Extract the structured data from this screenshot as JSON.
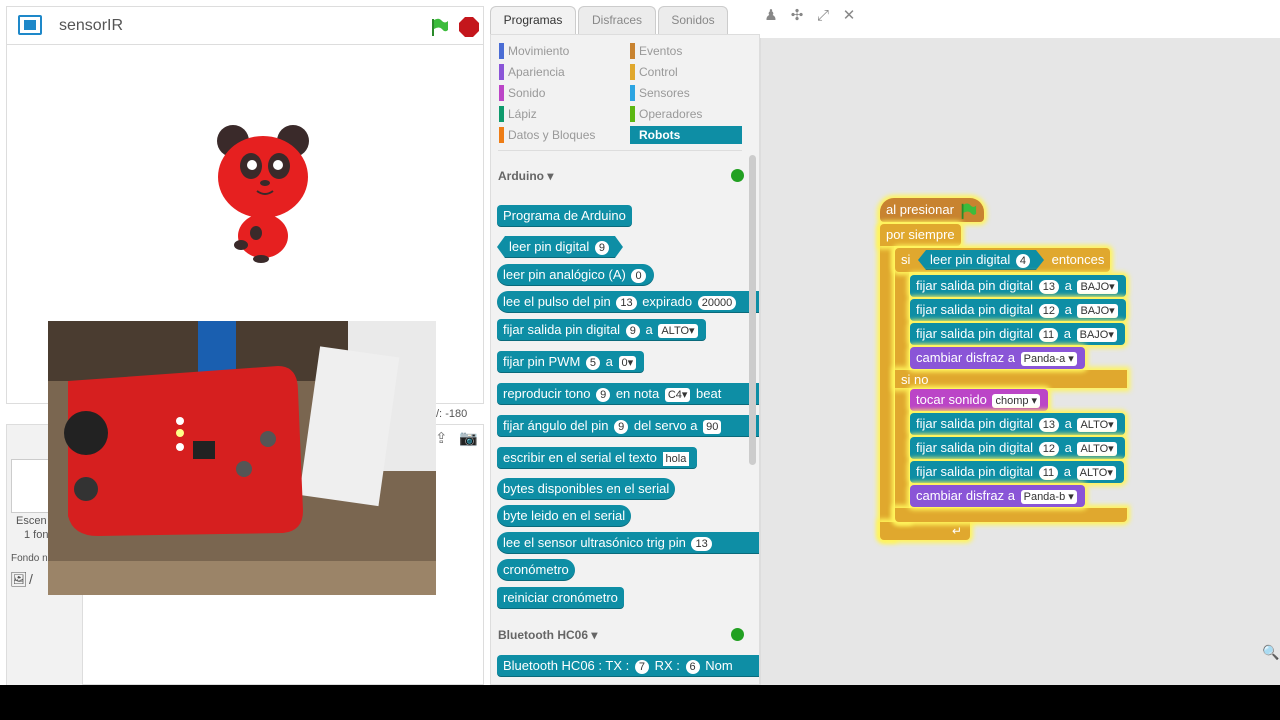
{
  "stage": {
    "project_title": "sensorIR",
    "coords_label": "-180",
    "coords_prefix": "/:"
  },
  "sprite_panel": {
    "stage_label": "Escen",
    "backdrop_count": "1 fon",
    "new_backdrop": "Fondo n"
  },
  "tabs": [
    "Programas",
    "Disfraces",
    "Sonidos"
  ],
  "categories": [
    {
      "label": "Movimiento",
      "color": "#4a6cd4"
    },
    {
      "label": "Apariencia",
      "color": "#8a55d7"
    },
    {
      "label": "Sonido",
      "color": "#bb45c7"
    },
    {
      "label": "Lápiz",
      "color": "#0e9a6c"
    },
    {
      "label": "Datos y Bloques",
      "color": "#ee7d16"
    },
    {
      "label": "Eventos",
      "color": "#c88330"
    },
    {
      "label": "Control",
      "color": "#e0a82e"
    },
    {
      "label": "Sensores",
      "color": "#2ca5e2"
    },
    {
      "label": "Operadores",
      "color": "#5cb712"
    },
    {
      "label": "Robots",
      "color": "#0e8ea5"
    }
  ],
  "palette": {
    "arduino_header": "Arduino",
    "bluetooth_header": "Bluetooth HC06",
    "blocks": {
      "programa": "Programa de Arduino",
      "leer_digital": "leer pin digital",
      "leer_digital_n": "9",
      "leer_analog": "leer pin analógico (A)",
      "leer_analog_n": "0",
      "pulso_a": "lee el pulso del pin",
      "pulso_n": "13",
      "pulso_b": "expirado",
      "pulso_t": "20000",
      "fijar_dig_a": "fijar salida pin digital",
      "fijar_dig_n": "9",
      "fijar_dig_b": "a",
      "fijar_dig_v": "ALTO▾",
      "pwm_a": "fijar pin PWM",
      "pwm_n": "5",
      "pwm_b": "a",
      "pwm_v": "0▾",
      "tono_a": "reproducir tono",
      "tono_n": "9",
      "tono_b": "en nota",
      "tono_v": "C4▾",
      "tono_c": "beat",
      "servo_a": "fijar ángulo del pin",
      "servo_n": "9",
      "servo_b": "del servo a",
      "servo_v": "90",
      "serial_a": "escribir en el serial el texto",
      "serial_v": "hola",
      "bytes_disp": "bytes disponibles en el serial",
      "byte_leido": "byte leido en el serial",
      "ultra_a": "lee el sensor ultrasónico trig pin",
      "ultra_n": "13",
      "crono": "cronómetro",
      "reiniciar": "reiniciar cronómetro",
      "bt_a": "Bluetooth HC06 : TX :",
      "bt_tx": "7",
      "bt_b": "RX :",
      "bt_rx": "6",
      "bt_c": "Nom"
    }
  },
  "script": {
    "hat": "al presionar",
    "forever": "por siempre",
    "if": "si",
    "if_cond": "leer pin digital",
    "if_cond_n": "4",
    "then": "entonces",
    "else": "si no",
    "set_label": "fijar salida pin digital",
    "a": "a",
    "costume_label": "cambiar disfraz a",
    "sound_label": "tocar sonido",
    "sound_value": "chomp ▾",
    "then_branch": [
      {
        "pin": "13",
        "value": "BAJO▾"
      },
      {
        "pin": "12",
        "value": "BAJO▾"
      },
      {
        "pin": "11",
        "value": "BAJO▾"
      }
    ],
    "then_costume": "Panda-a ▾",
    "else_branch": [
      {
        "pin": "13",
        "value": "ALTO▾"
      },
      {
        "pin": "12",
        "value": "ALTO▾"
      },
      {
        "pin": "11",
        "value": "ALTO▾"
      }
    ],
    "else_costume": "Panda-b ▾"
  }
}
